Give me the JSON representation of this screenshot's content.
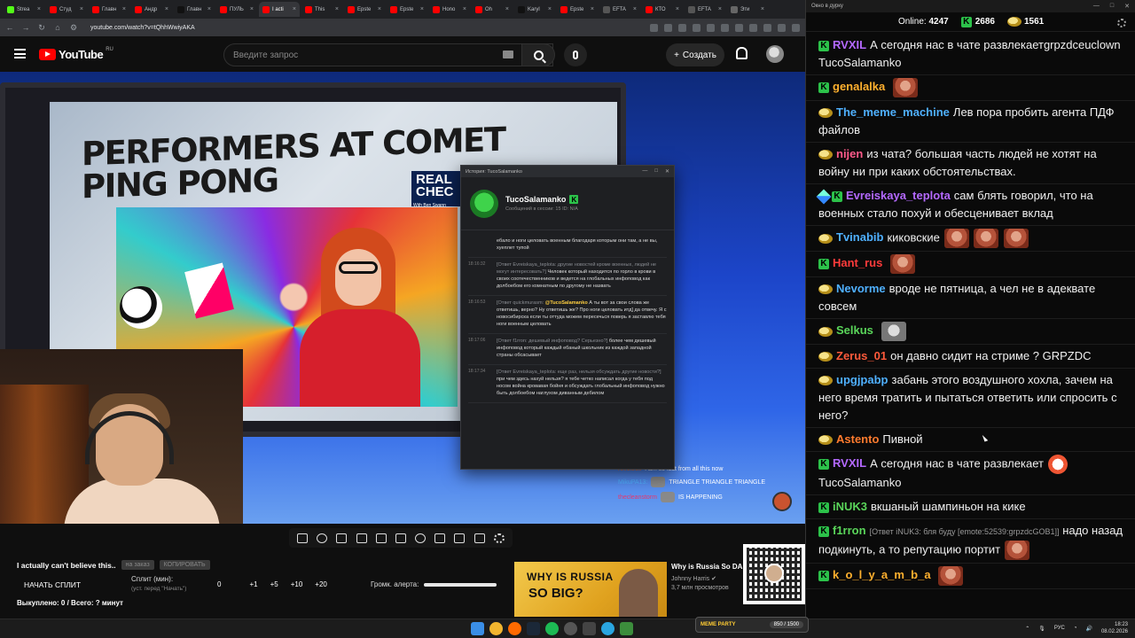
{
  "browser": {
    "tabs": [
      {
        "label": "Strea",
        "color": "#53fc18"
      },
      {
        "label": "Студ",
        "color": "#ff0000"
      },
      {
        "label": "Главн",
        "color": "#ff0000"
      },
      {
        "label": "Андр",
        "color": "#ff0000"
      },
      {
        "label": "Главн",
        "color": "#111111"
      },
      {
        "label": "ПУЛЬ",
        "color": "#ff0000"
      },
      {
        "label": "I acti",
        "color": "#ff0000",
        "active": true
      },
      {
        "label": "This",
        "color": "#ff0000"
      },
      {
        "label": "Epste",
        "color": "#ff0000"
      },
      {
        "label": "Epste",
        "color": "#ff0000"
      },
      {
        "label": "Hono",
        "color": "#ff0000"
      },
      {
        "label": "Oh",
        "color": "#ff0000"
      },
      {
        "label": "Karyl",
        "color": "#111111"
      },
      {
        "label": "Epste",
        "color": "#ff0000"
      },
      {
        "label": "EFTA",
        "color": "#555555"
      },
      {
        "label": "КТО",
        "color": "#ff0000"
      },
      {
        "label": "EFTA",
        "color": "#555555"
      },
      {
        "label": "Эти",
        "color": "#666666"
      }
    ],
    "url": "youtube.com/watch?v=tQhhWwiyAKA"
  },
  "youtube": {
    "logo": "YouTube",
    "country": "RU",
    "search_placeholder": "Введите запрос",
    "create_label": "Создать"
  },
  "video": {
    "headline_line1": "PERFORMERS AT COMET",
    "headline_line2": "PING PONG",
    "real_check": "REAL CHEC",
    "with_host": "With Ben Swann",
    "overlay_chat": [
      {
        "name": "revolecit",
        "text": "I am so lost from all this now"
      },
      {
        "name": "MikuPA13:",
        "text": "TRIANGLE  TRIANGLE  TRIANGLE"
      },
      {
        "name": "thecleanstorm",
        "text": "IS HAPPENING"
      }
    ]
  },
  "popup": {
    "window_title": "История: TucoSalamanko",
    "username": "TucoSalamanko",
    "meta": "Сообщений в сессии: 15    ID: N/A",
    "messages": [
      {
        "time": "",
        "ref": "",
        "mention": "",
        "text": "ебало и ноги целовать военным благодаря которым они там, а не вы, хуеплет тупой"
      },
      {
        "time": "18:16:32",
        "ref": "[Ответ Evreiskaya_teplota: другие новостей кроме военных, людей не могут интересовать?]",
        "mention": "",
        "text": "Человек который находится по горло в крови в своих соотечественников и ведется на глобальных инфоповод как долбоебом его комнатным по другому не назвать"
      },
      {
        "time": "18:16:53",
        "ref": "[Ответ quickmurasm:",
        "mention": "@TucoSalamanko",
        "text": "А ты вот за свои слова же ответишь, верно? Ну ответишь же? Про ноги целовать итд] да отвечу. Я с новосибирска если ты оттуда можем пересечься поверь я заставлю тебя ноги военным целовать"
      },
      {
        "time": "18:17:06",
        "ref": "[Ответ f1rron: дешевый инфоповод? Серьезно?]",
        "mention": "",
        "text": "более чем дешевый инфоповод который каждый ебаный школьник из каждой западной страны обсасывает"
      },
      {
        "time": "18:17:34",
        "ref": "[Ответ Evreiskaya_teplota: еще раз, нельзя обсуждать другие новости?]",
        "mention": "",
        "text": "при чем здесь нахуй нельзя? я тебе четко написал когда у тебя под носом война кровавая бойня и обсуждать глобальный инфоповод нужно быть долбоебом наглухом диванным дебилом"
      }
    ]
  },
  "controls": {
    "stream_title": "I actually can't believe this..",
    "chip1": "на заказ",
    "chip2": "КОПИРОВАТЬ",
    "split_button": "НАЧАТЬ СПЛИТ",
    "split_label": "Сплит (мин):",
    "split_hint": "(уст. перед \"Начать\")",
    "split_values": [
      "0",
      "+1",
      "+5",
      "+10",
      "+20"
    ],
    "alert_label": "Громк. алерта:",
    "alert_level": 1.0,
    "bought": "Выкуплено: 0 / Всего: ? минут"
  },
  "recommended": {
    "thumb_line1": "WHY IS RUSSIA",
    "thumb_line2": "SO BIG?",
    "title": "Why is Russia So DA",
    "channel": "Johnny Harris",
    "views": "3,7 млн просмотров"
  },
  "chat_window": {
    "title": "Окно в дурку",
    "online_label": "Online:",
    "online_value": "4247",
    "k_count": "2686",
    "coin_count": "1561",
    "messages": [
      {
        "badge": "k",
        "name": "RVXIL",
        "color": "#b469ff",
        "text": "А сегодня нас в чате развлекаетgrpzdceuclown TucoSalamanko",
        "emotes": []
      },
      {
        "badge": "k",
        "name": "genalalka",
        "color": "#ffb02e",
        "text": "",
        "emotes": [
          "face"
        ]
      },
      {
        "badge": "coin",
        "name": "The_meme_machine",
        "color": "#4fb0ff",
        "text": "Лев пора пробить агента ПДФ файлов",
        "emotes": []
      },
      {
        "badge": "coin",
        "name": "nijen",
        "color": "#ff5a8a",
        "text": "из чата? большая часть людей не хотят на войну ни при каких обстоятельствах.",
        "emotes": []
      },
      {
        "badge": "dart",
        "name": "Evreiskaya_teplota",
        "color": "#b469ff",
        "text": "сам блять говорил, что на военных стало похуй и обесценивает вклад",
        "emotes": []
      },
      {
        "badge": "coin",
        "name": "Tvinabib",
        "color": "#4fb0ff",
        "text": "киковские",
        "emotes": [
          "face",
          "face",
          "face"
        ]
      },
      {
        "badge": "k",
        "name": "Hant_rus",
        "color": "#ff3b3b",
        "text": "",
        "emotes": [
          "face"
        ]
      },
      {
        "badge": "coin",
        "name": "Nevorme",
        "color": "#4fb0ff",
        "text": "вроде не пятница, а чел не в адеквате совсем",
        "emotes": []
      },
      {
        "badge": "coin",
        "name": "Selkus",
        "color": "#5ad65a",
        "text": "",
        "emotes": [
          "grey"
        ]
      },
      {
        "badge": "coin",
        "name": "Zerus_01",
        "color": "#ff5a3b",
        "text": "он давно сидит на стриме ? GRPZDC",
        "emotes": []
      },
      {
        "badge": "coin",
        "name": "upgjpabp",
        "color": "#4fb0ff",
        "text": "забань этого воздушного хохла, зачем на него время тратить и пытаться ответить или спросить с него?",
        "emotes": []
      },
      {
        "badge": "coin",
        "name": "Astento",
        "color": "#ff7b2e",
        "text": "Пивной",
        "emotes": []
      },
      {
        "badge": "k",
        "name": "RVXIL",
        "color": "#b469ff",
        "text": "А сегодня нас в чате развлекает",
        "emotes": [
          "clown"
        ],
        "tail": "TucoSalamanko"
      },
      {
        "badge": "k",
        "name": "iNUK3",
        "color": "#5ad65a",
        "text": "вкшаный шампиньон на кике",
        "emotes": []
      },
      {
        "badge": "k",
        "name": "f1rron",
        "color": "#5ad65a",
        "reply": "[Ответ iNUK3: бля буду [emote:52539:grpzdcGOB1]]",
        "text": "надо назад подкинуть, а то репутацию портит",
        "emotes": [
          "face"
        ]
      },
      {
        "badge": "k",
        "name": "k_o_l_y_a_m_b_a",
        "color": "#ffb02e",
        "text": "",
        "emotes": [
          "face"
        ]
      }
    ]
  },
  "taskbar": {
    "meme_label": "MEME PARTY",
    "meme_progress": "850 / 1500",
    "lang": "РУС",
    "time": "18:23",
    "date": "08.02.2026"
  },
  "colors": {
    "accent_kick": "#2cc24a",
    "yt_red": "#ff0000"
  }
}
